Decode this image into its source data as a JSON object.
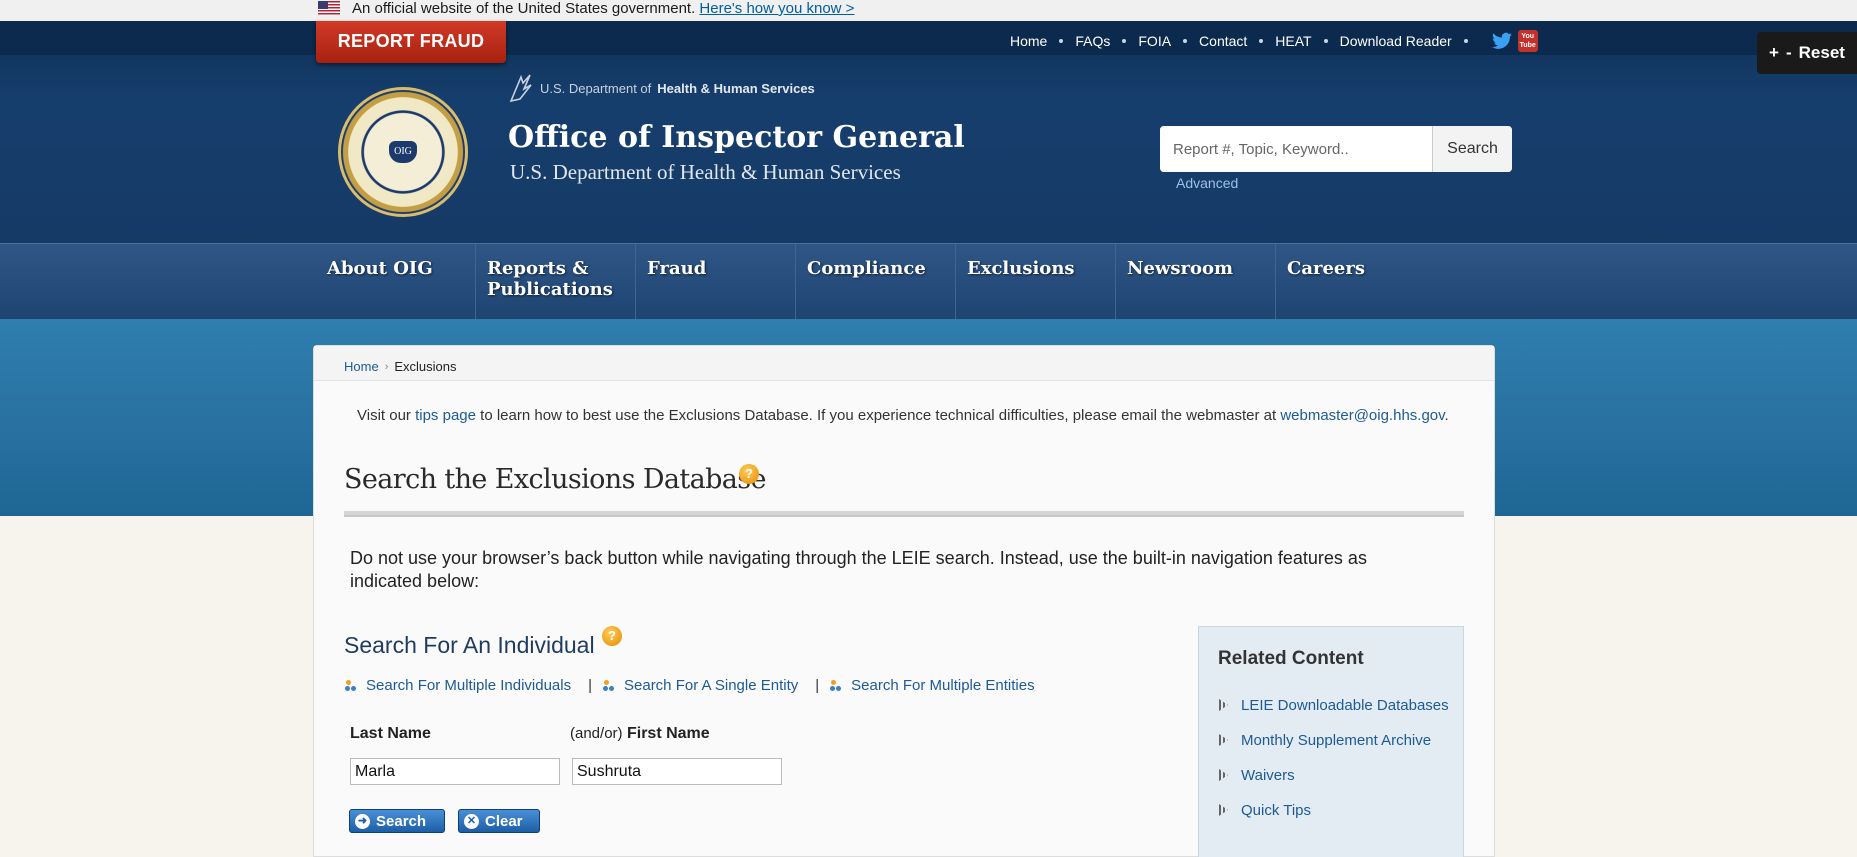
{
  "gov_banner": {
    "text": "An official website of the United States government.",
    "link": "Here's how you know >"
  },
  "header": {
    "report_fraud": "REPORT FRAUD",
    "util_nav": [
      "Home",
      "FAQs",
      "FOIA",
      "Contact",
      "HEAT",
      "Download Reader"
    ],
    "hhs_prefix": "U.S. Department of",
    "hhs_bold": "Health & Human Services",
    "seal_text": "OIG",
    "title": "Office of Inspector General",
    "subtitle": "U.S. Department of Health & Human Services",
    "search_placeholder": "Report #, Topic, Keyword..",
    "search_button": "Search",
    "advanced": "Advanced",
    "youtube_label": "You Tube"
  },
  "reset_widget": {
    "plus": "+",
    "minus": "-",
    "label": "Reset"
  },
  "main_nav": [
    "About OIG",
    "Reports & Publications",
    "Fraud",
    "Compliance",
    "Exclusions",
    "Newsroom",
    "Careers"
  ],
  "breadcrumb": {
    "home": "Home",
    "current": "Exclusions"
  },
  "tips": {
    "before": "Visit our ",
    "link": "tips page",
    "middle": " to learn how to best use the Exclusions Database. If you experience technical difficulties, please email the webmaster at ",
    "email": "webmaster@oig.hhs.gov",
    "after": "."
  },
  "page_title": "Search the Exclusions Database",
  "help_glyph": "?",
  "warning": "Do not use your browser’s back button while navigating through the LEIE search. Instead, use the built-in navigation features as indicated below:",
  "search_individual": {
    "heading": "Search For An Individual",
    "links": [
      "Search For Multiple Individuals",
      "Search For A Single Entity",
      "Search For Multiple Entities"
    ],
    "separator": "|",
    "last_name_label": "Last Name",
    "first_name_prefix": "(and/or)",
    "first_name_label": "First Name",
    "last_name_value": "Marla",
    "first_name_value": "Sushruta",
    "search_button": "Search",
    "clear_button": "Clear"
  },
  "related_content": {
    "title": "Related Content",
    "items": [
      "LEIE Downloadable Databases",
      "Monthly Supplement Archive",
      "Waivers",
      "Quick Tips"
    ]
  },
  "colors": {
    "header_blue": "#163e6d",
    "report_red": "#c42e1c",
    "link_blue": "#1d5a96",
    "band_blue": "#2a76a6"
  },
  "icons": [
    "flag-icon",
    "twitter-icon",
    "youtube-icon",
    "hhs-eagle-icon",
    "help-icon",
    "link-bullet-icon",
    "search-icon",
    "clear-icon",
    "arrow-bullet-icon"
  ]
}
